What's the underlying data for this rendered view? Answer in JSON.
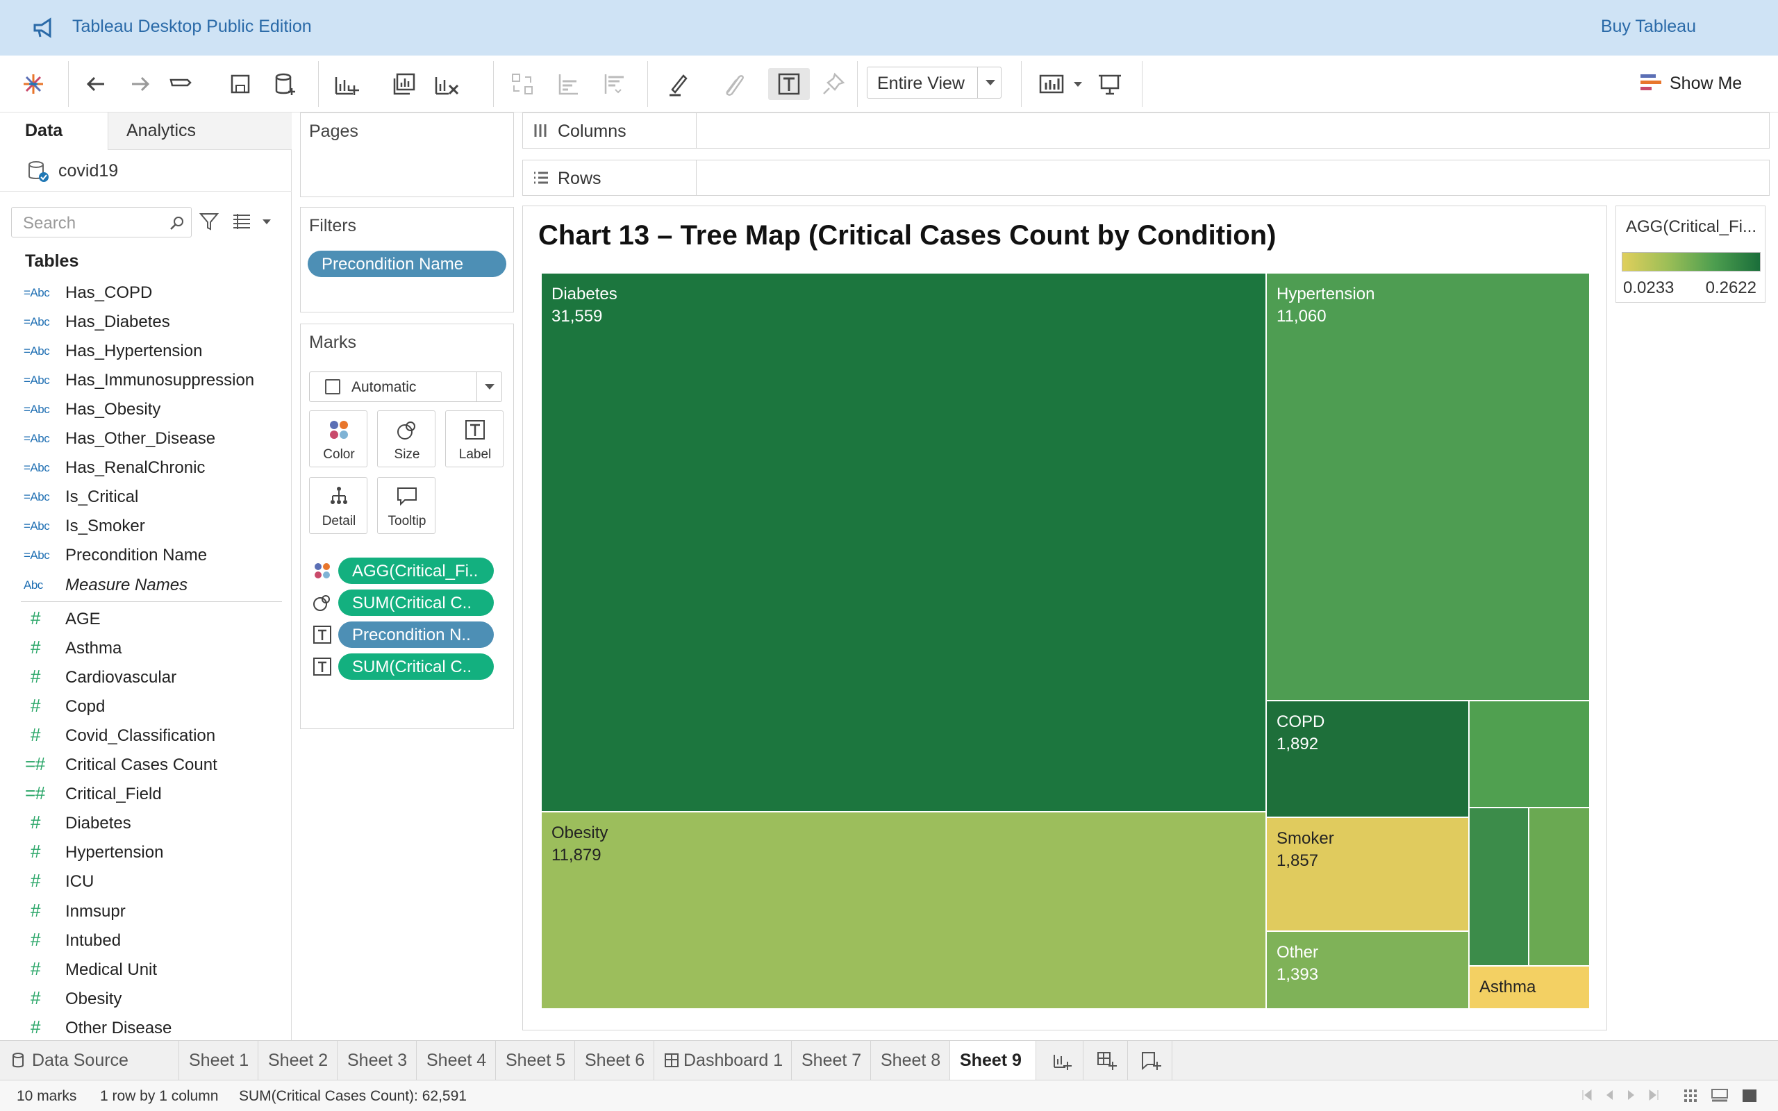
{
  "banner": {
    "title": "Tableau Desktop Public Edition",
    "buy_label": "Buy Tableau"
  },
  "toolbar": {
    "fit_value": "Entire View",
    "show_me_label": "Show Me"
  },
  "data_pane": {
    "tab_data": "Data",
    "tab_analytics": "Analytics",
    "datasource": "covid19",
    "search_placeholder": "Search",
    "tables_header": "Tables",
    "dimension_fields": [
      {
        "icon": "=Abc",
        "label": "Has_COPD"
      },
      {
        "icon": "=Abc",
        "label": "Has_Diabetes"
      },
      {
        "icon": "=Abc",
        "label": "Has_Hypertension"
      },
      {
        "icon": "=Abc",
        "label": "Has_Immunosuppression"
      },
      {
        "icon": "=Abc",
        "label": "Has_Obesity"
      },
      {
        "icon": "=Abc",
        "label": "Has_Other_Disease"
      },
      {
        "icon": "=Abc",
        "label": "Has_RenalChronic"
      },
      {
        "icon": "=Abc",
        "label": "Is_Critical"
      },
      {
        "icon": "=Abc",
        "label": "Is_Smoker"
      },
      {
        "icon": "=Abc",
        "label": "Precondition Name"
      },
      {
        "icon": "Abc",
        "label": "Measure Names"
      }
    ],
    "measure_fields": [
      {
        "icon": "#",
        "label": "AGE"
      },
      {
        "icon": "#",
        "label": "Asthma"
      },
      {
        "icon": "#",
        "label": "Cardiovascular"
      },
      {
        "icon": "#",
        "label": "Copd"
      },
      {
        "icon": "#",
        "label": "Covid_Classification"
      },
      {
        "icon": "=#",
        "label": "Critical Cases Count"
      },
      {
        "icon": "=#",
        "label": "Critical_Field"
      },
      {
        "icon": "#",
        "label": "Diabetes"
      },
      {
        "icon": "#",
        "label": "Hypertension"
      },
      {
        "icon": "#",
        "label": "ICU"
      },
      {
        "icon": "#",
        "label": "Inmsupr"
      },
      {
        "icon": "#",
        "label": "Intubed"
      },
      {
        "icon": "#",
        "label": "Medical Unit"
      },
      {
        "icon": "#",
        "label": "Obesity"
      },
      {
        "icon": "#",
        "label": "Other Disease"
      }
    ]
  },
  "pages": {
    "header": "Pages"
  },
  "filters": {
    "header": "Filters",
    "pill": "Precondition Name"
  },
  "marks": {
    "header": "Marks",
    "type": "Automatic",
    "buttons": [
      "Color",
      "Size",
      "Label",
      "Detail",
      "Tooltip"
    ],
    "pills": [
      "AGG(Critical_Fi..",
      "SUM(Critical C..",
      "Precondition N..",
      "SUM(Critical C.."
    ]
  },
  "shelves": {
    "columns": "Columns",
    "rows": "Rows"
  },
  "chart_data": {
    "type": "treemap",
    "title": "Chart 13 – Tree Map (Critical Cases Count by Condition)",
    "tiles": [
      {
        "name": "Diabetes",
        "value": "31,559",
        "color": "#1c763e"
      },
      {
        "name": "Hypertension",
        "value": "11,060",
        "color": "#4e9d52"
      },
      {
        "name": "Obesity",
        "value": "11,879",
        "color": "#9cbe5c"
      },
      {
        "name": "COPD",
        "value": "1,892",
        "color": "#1e6f3a"
      },
      {
        "name": "Smoker",
        "value": "1,857",
        "color": "#e0cb5e"
      },
      {
        "name": "Other",
        "value": "1,393",
        "color": "#7fb258"
      },
      {
        "name": "Asthma",
        "value": "",
        "color": "#f3d063"
      }
    ],
    "unlabeled_tile_colors": [
      "#50a050",
      "#3c8c4a",
      "#6aa952"
    ]
  },
  "legend": {
    "title": "AGG(Critical_Fi...",
    "min": "0.0233",
    "max": "0.2622"
  },
  "sheet_tabs": {
    "data_source": "Data Source",
    "tabs": [
      "Sheet 1",
      "Sheet 2",
      "Sheet 3",
      "Sheet 4",
      "Sheet 5",
      "Sheet 6",
      "Dashboard 1",
      "Sheet 7",
      "Sheet 8",
      "Sheet 9"
    ],
    "active": "Sheet 9"
  },
  "status": {
    "marks": "10 marks",
    "dims": "1 row by 1 column",
    "sum": "SUM(Critical Cases Count): 62,591"
  }
}
